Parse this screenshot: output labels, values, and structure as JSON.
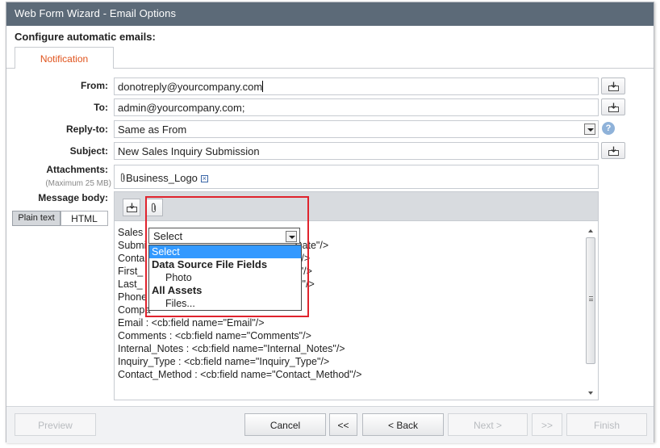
{
  "window": {
    "title": "Web Form Wizard - Email Options"
  },
  "heading": "Configure automatic emails:",
  "tabs": [
    {
      "label": "Notification"
    }
  ],
  "form": {
    "from": {
      "label": "From:",
      "value": "donotreply@yourcompany.com"
    },
    "to": {
      "label": "To:",
      "value": "admin@yourcompany.com;"
    },
    "reply_to": {
      "label": "Reply-to:",
      "value": "Same as From"
    },
    "subject": {
      "label": "Subject:",
      "value": "New Sales Inquiry Submission"
    },
    "attachments": {
      "label": "Attachments:",
      "note": "(Maximum 25 MB)",
      "file": "Business_Logo"
    },
    "message_body": {
      "label": "Message body:"
    }
  },
  "body_modes": {
    "plain": "Plain text",
    "html": "HTML"
  },
  "editor_lines": [
    "Sales",
    "Submi                                                   _Date\"/>",
    "Conta                                                    D\"/>",
    "First_                                                    ne\"/>",
    "Last_                                                     ne\"/>",
    "Phone",
    "Compa",
    "Email : <cb:field name=\"Email\"/>",
    "Comments : <cb:field name=\"Comments\"/>",
    "Internal_Notes : <cb:field name=\"Internal_Notes\"/>",
    "Inquiry_Type : <cb:field name=\"Inquiry_Type\"/>",
    "Contact_Method : <cb:field name=\"Contact_Method\"/>"
  ],
  "insert_dropdown": {
    "selected": "Select",
    "options": [
      {
        "label": "Select",
        "kind": "selected"
      },
      {
        "label": "Data Source File Fields",
        "kind": "group"
      },
      {
        "label": "Photo",
        "kind": "sub"
      },
      {
        "label": "All Assets",
        "kind": "group"
      },
      {
        "label": "Files...",
        "kind": "sub"
      }
    ]
  },
  "footer": {
    "preview": "Preview",
    "cancel": "Cancel",
    "first": "<<",
    "back": "< Back",
    "next": "Next >",
    "last": ">>",
    "finish": "Finish"
  },
  "colors": {
    "titlebar": "#5c6a78",
    "tab_text": "#e0531c",
    "highlight": "#e0232d",
    "selected_option": "#3399ff"
  },
  "icons": {
    "insert_field": "insert-field-icon",
    "attachment": "paperclip-icon",
    "help": "help-icon",
    "remove": "remove-x-icon"
  }
}
